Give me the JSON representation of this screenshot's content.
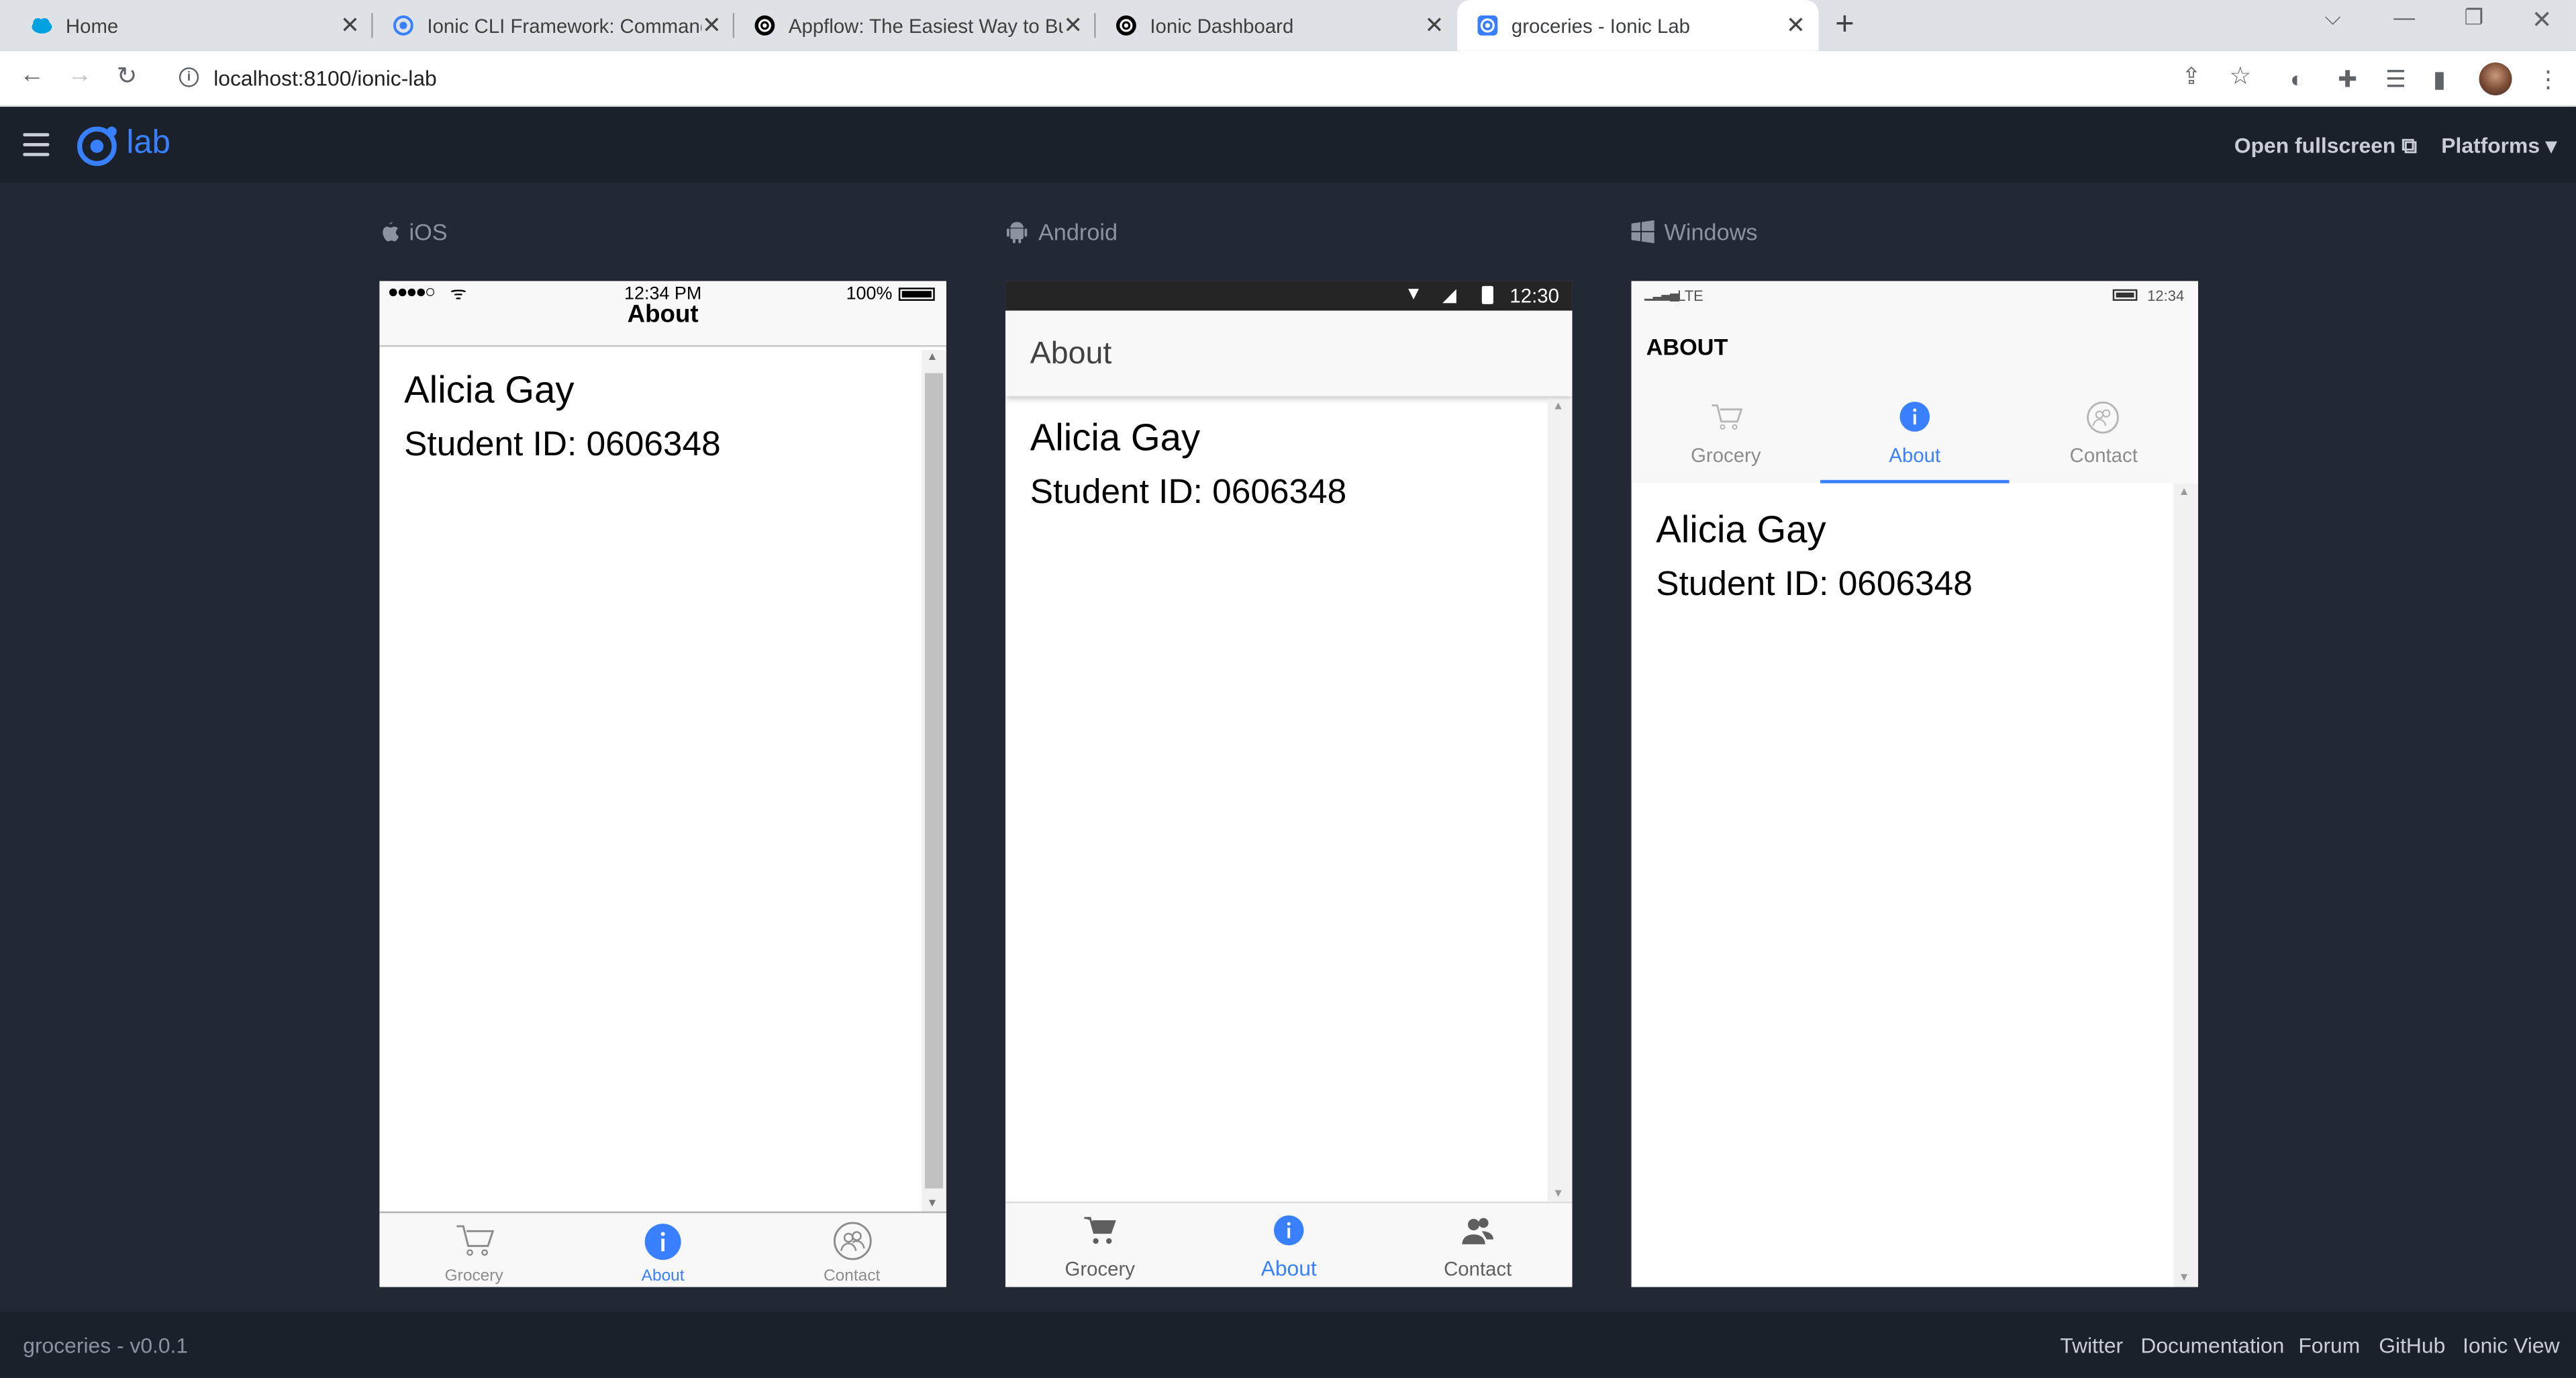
{
  "browser": {
    "tabs": [
      {
        "title": "Home",
        "favicon": "salesforce-cloud-icon"
      },
      {
        "title": "Ionic CLI Framework: Command-",
        "favicon": "ionic-icon"
      },
      {
        "title": "Appflow: The Easiest Way to Buil",
        "favicon": "appflow-icon"
      },
      {
        "title": "Ionic Dashboard",
        "favicon": "ionic-dark-icon"
      },
      {
        "title": "groceries - Ionic Lab",
        "favicon": "ionic-lab-icon",
        "active": true
      }
    ],
    "url": "localhost:8100/ionic-lab"
  },
  "lab": {
    "logo_text": "lab",
    "open_fullscreen": "Open fullscreen",
    "platforms": "Platforms"
  },
  "devices": {
    "ios": {
      "platform_label": "iOS",
      "status_time": "12:34 PM",
      "status_battery": "100%",
      "title": "About",
      "name": "Alicia Gay",
      "student_id": "Student ID: 0606348",
      "tabs": [
        "Grocery",
        "About",
        "Contact"
      ]
    },
    "android": {
      "platform_label": "Android",
      "status_time": "12:30",
      "title": "About",
      "name": "Alicia Gay",
      "student_id": "Student ID: 0606348",
      "tabs": [
        "Grocery",
        "About",
        "Contact"
      ]
    },
    "windows": {
      "platform_label": "Windows",
      "status_network": "LTE",
      "status_time": "12:34",
      "title": "ABOUT",
      "name": "Alicia Gay",
      "student_id": "Student ID: 0606348",
      "tabs": [
        "Grocery",
        "About",
        "Contact"
      ]
    }
  },
  "footer": {
    "app_version": "groceries - v0.0.1",
    "links": [
      "Twitter",
      "Documentation",
      "Forum",
      "GitHub",
      "Ionic View"
    ]
  },
  "colors": {
    "accent": "#3880ff",
    "lab_bg": "#222834",
    "header_bg": "#1b212b"
  }
}
